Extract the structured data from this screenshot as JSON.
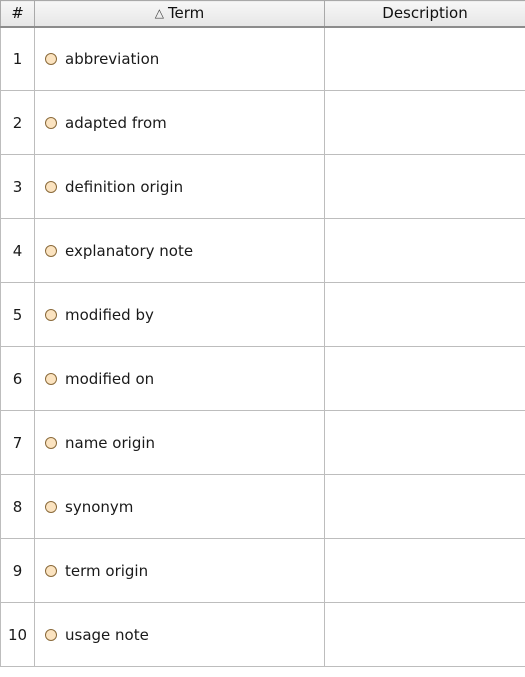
{
  "table": {
    "headers": {
      "number": "#",
      "sort_indicator": "△",
      "term": "Term",
      "description": "Description"
    },
    "rows": [
      {
        "num": "1",
        "term": "abbreviation",
        "description": ""
      },
      {
        "num": "2",
        "term": "adapted from",
        "description": ""
      },
      {
        "num": "3",
        "term": "definition origin",
        "description": ""
      },
      {
        "num": "4",
        "term": "explanatory note",
        "description": ""
      },
      {
        "num": "5",
        "term": "modified by",
        "description": ""
      },
      {
        "num": "6",
        "term": "modified on",
        "description": ""
      },
      {
        "num": "7",
        "term": "name origin",
        "description": ""
      },
      {
        "num": "8",
        "term": "synonym",
        "description": ""
      },
      {
        "num": "9",
        "term": "term origin",
        "description": ""
      },
      {
        "num": "10",
        "term": "usage note",
        "description": ""
      }
    ],
    "icon": "term-element-icon",
    "colors": {
      "icon_fill": "#fbe3c0",
      "icon_border": "#8a6a3a",
      "grid_line": "#bdbdbd"
    }
  }
}
